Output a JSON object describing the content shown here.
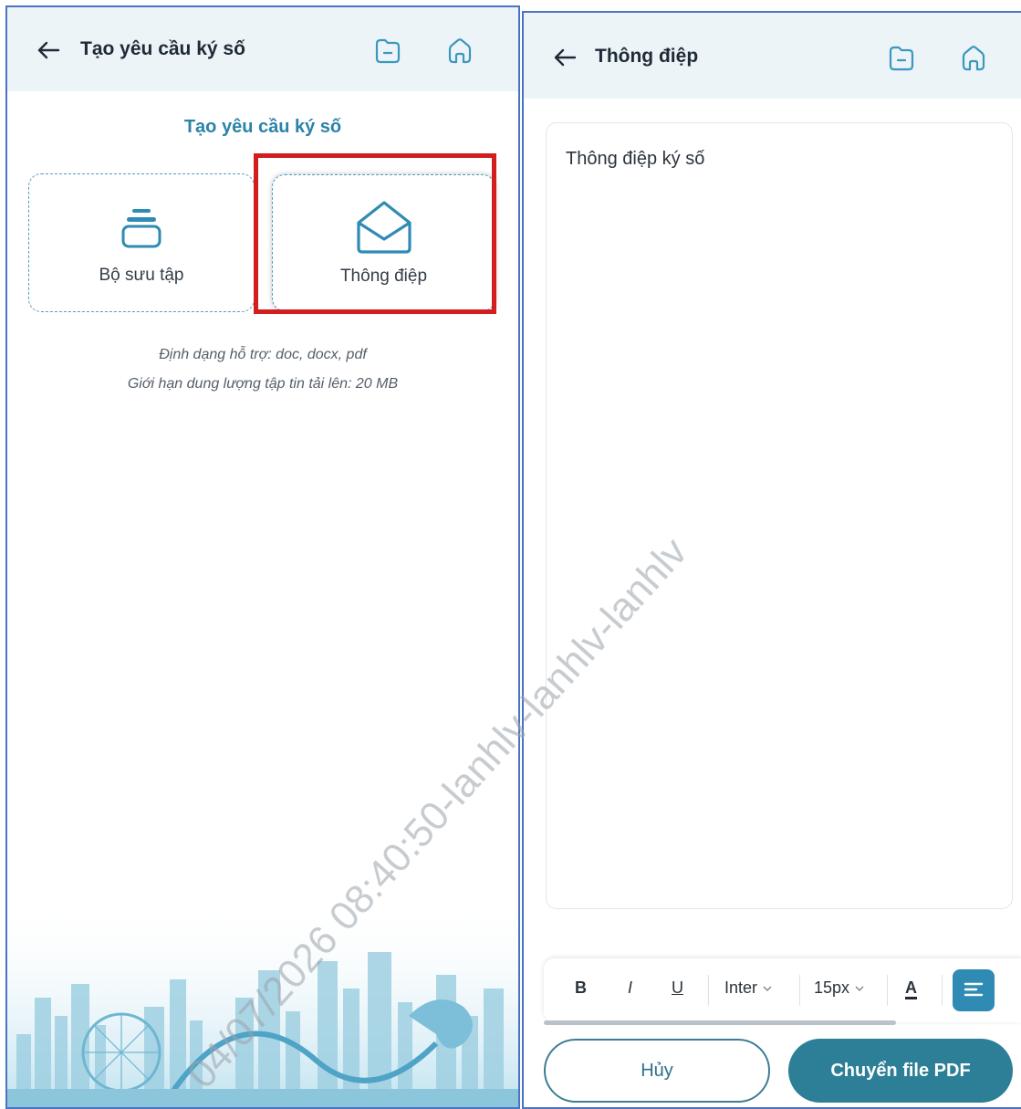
{
  "left_screen": {
    "header": {
      "back_icon": "arrow-left-icon",
      "title": "Tạo yêu cầu ký số",
      "folder_icon": "folder-icon",
      "home_icon": "home-icon"
    },
    "section_title": "Tạo yêu cầu ký số",
    "options": [
      {
        "label": "Bộ sưu tập",
        "icon": "stack-icon"
      },
      {
        "label": "Thông điệp",
        "icon": "envelope-open-icon"
      }
    ],
    "hints": {
      "format": "Định dạng hỗ trợ: doc, docx, pdf",
      "limit": "Giới hạn dung lượng tập tin tải lên: 20 MB"
    }
  },
  "right_screen": {
    "header": {
      "back_icon": "arrow-left-icon",
      "title": "Thông điệp",
      "folder_icon": "folder-icon",
      "home_icon": "home-icon"
    },
    "editor": {
      "content": "Thông điệp ký số"
    },
    "toolbar": {
      "bold": "B",
      "italic": "I",
      "underline": "U",
      "font_family": "Inter",
      "font_size": "15px",
      "text_color": "A",
      "align_icon": "align-left-icon"
    },
    "buttons": {
      "cancel": "Hủy",
      "convert": "Chuyển file PDF"
    }
  },
  "watermark": "04/07/2026 08:40:50-lanhlv-lanhlv-lanhlv",
  "colors": {
    "primary": "#2c7f96",
    "accent_title": "#2a83a8",
    "header_bg": "#ecf4f7",
    "highlight": "#d41d1d",
    "frame_border": "#4a74c2"
  }
}
